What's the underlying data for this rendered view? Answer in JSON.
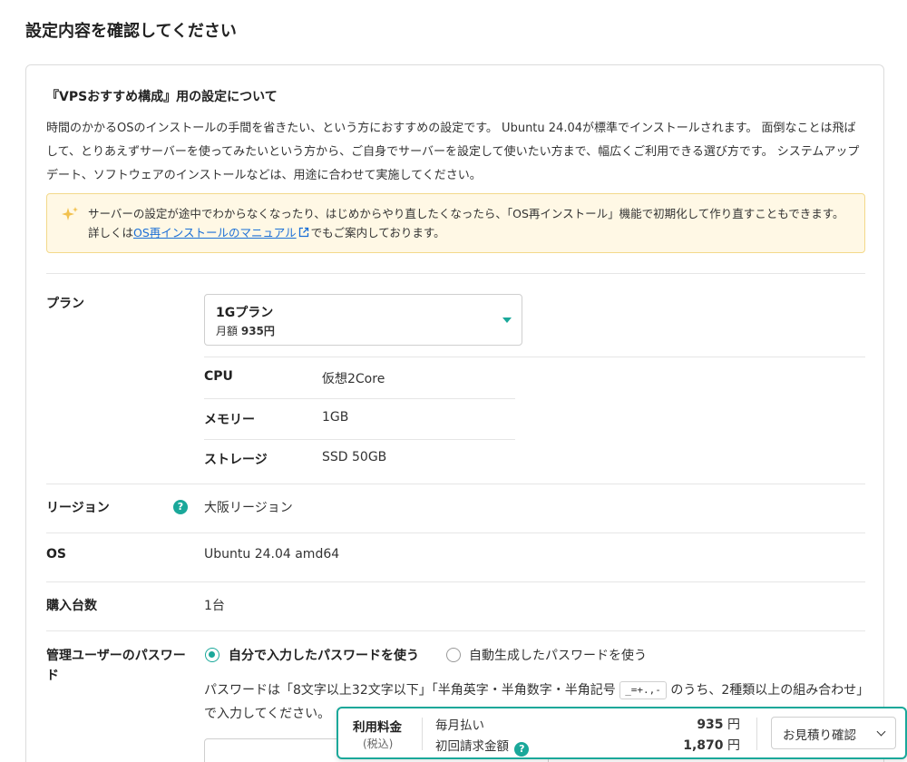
{
  "page": {
    "title": "設定内容を確認してください"
  },
  "intro": {
    "heading": "『VPSおすすめ構成』用の設定について",
    "description": "時間のかかるOSのインストールの手間を省きたい、という方におすすめの設定です。 Ubuntu 24.04が標準でインストールされます。 面倒なことは飛ばして、とりあえずサーバーを使ってみたいという方から、ご自身でサーバーを設定して使いたい方まで、幅広くご利用できる選び方です。 システムアップデート、ソフトウェアのインストールなどは、用途に合わせて実施してください。",
    "notice_before": "サーバーの設定が途中でわからなくなったり、はじめからやり直したくなったら、「OS再インストール」機能で初期化して作り直すこともできます。詳しくは",
    "notice_link": "OS再インストールのマニュアル",
    "notice_after": "でもご案内しております。"
  },
  "plan": {
    "label": "プラン",
    "selected_name": "1Gプラン",
    "price_prefix": "月額",
    "price": "935円",
    "specs": [
      {
        "key": "CPU",
        "value": "仮想2Core"
      },
      {
        "key": "メモリー",
        "value": "1GB"
      },
      {
        "key": "ストレージ",
        "value": "SSD 50GB"
      }
    ]
  },
  "region": {
    "label": "リージョン",
    "help": "?",
    "value": "大阪リージョン"
  },
  "os": {
    "label": "OS",
    "value": "Ubuntu 24.04 amd64"
  },
  "count": {
    "label": "購入台数",
    "value": "1台"
  },
  "password": {
    "label": "管理ユーザーのパスワード",
    "option_manual": "自分で入力したパスワードを使う",
    "option_auto": "自動生成したパスワードを使う",
    "selected": "manual",
    "desc_before": "パスワードは「8文字以上32文字以下」「半角英字・半角数字・半角記号",
    "symbols": "_=+.,-",
    "desc_after": "のうち、2種類以上の組み合わせ」で入力してください。",
    "value": ""
  },
  "fee_bar": {
    "title": "利用料金",
    "tax_note": "(税込)",
    "monthly_label": "毎月払い",
    "monthly_value": "935",
    "initial_label": "初回請求金額",
    "initial_value": "1,870",
    "currency": "円",
    "estimate_button": "お見積り確認"
  },
  "colors": {
    "accent": "#1aa89a",
    "notice_bg": "#fff8e5",
    "link": "#1a6fd6"
  }
}
